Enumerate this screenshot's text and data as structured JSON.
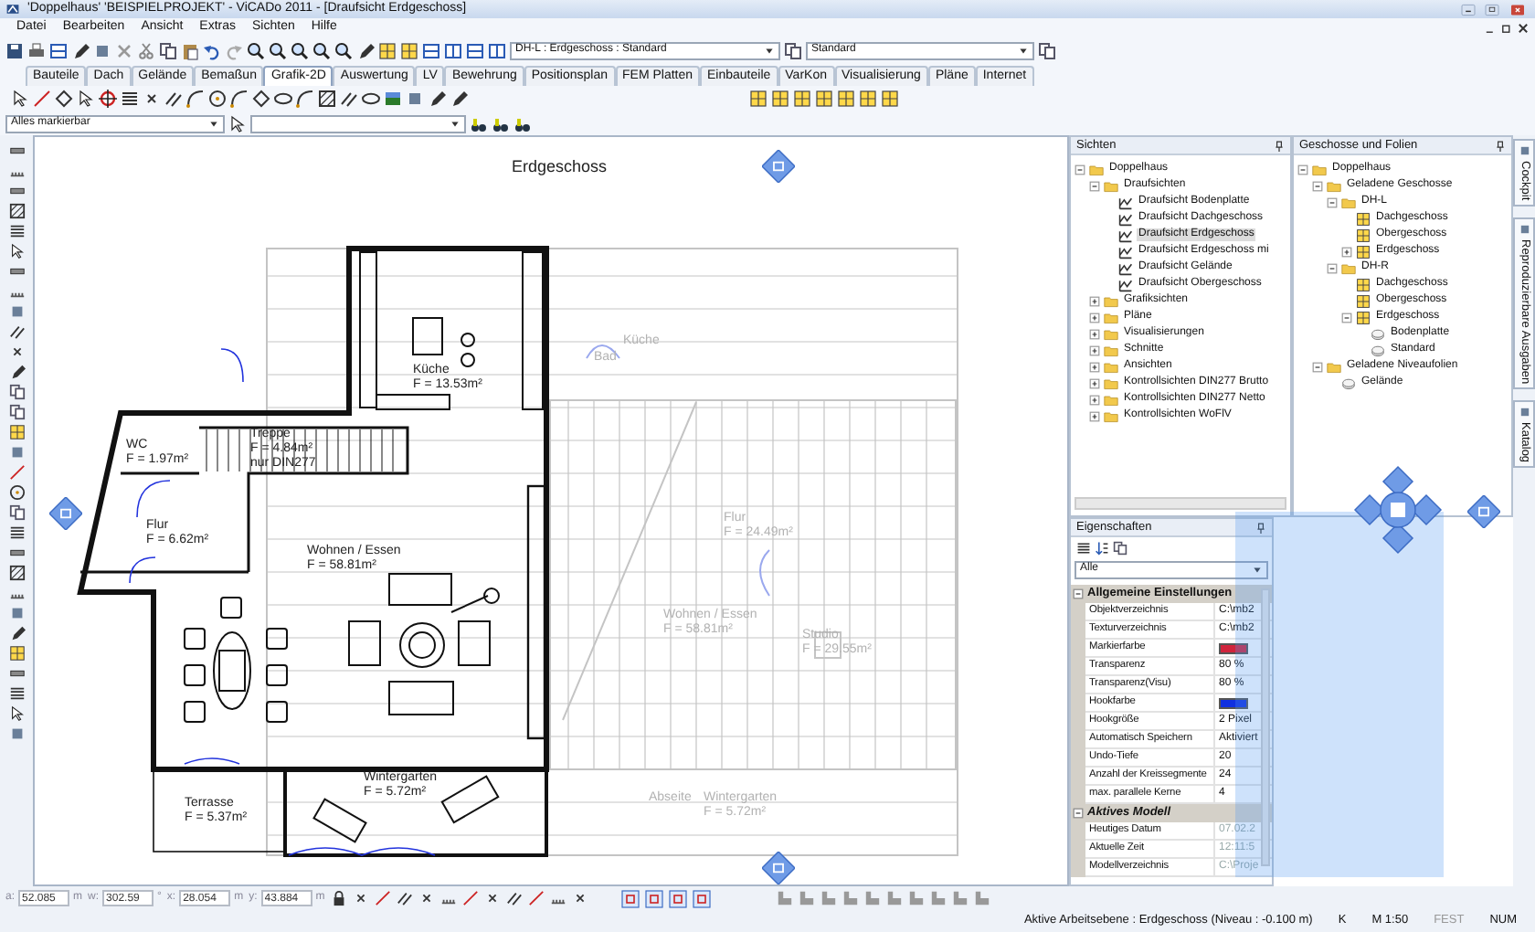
{
  "window": {
    "title": "'Doppelhaus' 'BEISPIELPROJEKT' - ViCADo 2011 - [Draufsicht Erdgeschoss]"
  },
  "menu": [
    "Datei",
    "Bearbeiten",
    "Ansicht",
    "Extras",
    "Sichten",
    "Hilfe"
  ],
  "toolbar": {
    "layer_combo": "DH-L : Erdgeschoss : Standard",
    "style_combo": "Standard"
  },
  "ribbon_tabs": [
    {
      "label": "Bauteile",
      "selected": false
    },
    {
      "label": "Dach",
      "selected": false
    },
    {
      "label": "Gelände",
      "selected": false
    },
    {
      "label": "Bemaßun",
      "selected": false
    },
    {
      "label": "Grafik-2D",
      "selected": true
    },
    {
      "label": "Auswertung",
      "selected": false
    },
    {
      "label": "LV",
      "selected": false
    },
    {
      "label": "Bewehrung",
      "selected": false
    },
    {
      "label": "Positionsplan",
      "selected": false
    },
    {
      "label": "FEM Platten",
      "selected": false
    },
    {
      "label": "Einbauteile",
      "selected": false
    },
    {
      "label": "VarKon",
      "selected": false
    },
    {
      "label": "Visualisierung",
      "selected": false
    },
    {
      "label": "Pläne",
      "selected": false
    },
    {
      "label": "Internet",
      "selected": false
    }
  ],
  "selection_filter": "Alles markierbar",
  "drawing": {
    "title": "Erdgeschoss",
    "rooms": [
      {
        "lines": [
          "Bad"
        ],
        "faded": true
      },
      {
        "lines": [
          "Küche"
        ],
        "faded": true
      },
      {
        "lines": [
          "Küche",
          "F = 13.53m²"
        ],
        "faded": false
      },
      {
        "lines": [
          "WC",
          "F = 1.97m²"
        ],
        "faded": false
      },
      {
        "lines": [
          "Treppe",
          "F = 4.84m²",
          "nur DIN277"
        ],
        "faded": false
      },
      {
        "lines": [
          "Flur",
          "F = 6.62m²"
        ],
        "faded": false
      },
      {
        "lines": [
          "Flur",
          "F = 24.49m²"
        ],
        "faded": true
      },
      {
        "lines": [
          "Wohnen / Essen",
          "F = 58.81m²"
        ],
        "faded": false
      },
      {
        "lines": [
          "Wohnen / Essen",
          "F = 58.81m²"
        ],
        "faded": true
      },
      {
        "lines": [
          "Studio",
          "F = 29.55m²"
        ],
        "faded": true
      },
      {
        "lines": [
          "Terrasse",
          "F = 5.37m²"
        ],
        "faded": false
      },
      {
        "lines": [
          "Wintergarten",
          "F = 5.72m²"
        ],
        "faded": false
      },
      {
        "lines": [
          "Abseite"
        ],
        "faded": true
      },
      {
        "lines": [
          "Wintergarten",
          "F = 5.72m²"
        ],
        "faded": true
      }
    ]
  },
  "views_panel": {
    "title": "Sichten",
    "tree": [
      {
        "label": "Doppelhaus",
        "kind": "folder",
        "expanded": true,
        "selected": false,
        "children": [
          {
            "label": "Draufsichten",
            "kind": "folder",
            "expanded": true,
            "selected": false,
            "children": [
              {
                "label": "Draufsicht Bodenplatte",
                "kind": "view",
                "selected": false
              },
              {
                "label": "Draufsicht Dachgeschoss",
                "kind": "view",
                "selected": false
              },
              {
                "label": "Draufsicht Erdgeschoss",
                "kind": "view",
                "selected": true
              },
              {
                "label": "Draufsicht Erdgeschoss mi",
                "kind": "view",
                "selected": false
              },
              {
                "label": "Draufsicht Gelände",
                "kind": "view",
                "selected": false
              },
              {
                "label": "Draufsicht Obergeschoss",
                "kind": "view",
                "selected": false
              }
            ]
          },
          {
            "label": "Grafiksichten",
            "kind": "folder",
            "expanded": false,
            "selected": false
          },
          {
            "label": "Pläne",
            "kind": "folder",
            "expanded": false,
            "selected": false
          },
          {
            "label": "Visualisierungen",
            "kind": "folder",
            "expanded": false,
            "selected": false
          },
          {
            "label": "Schnitte",
            "kind": "folder",
            "expanded": false,
            "selected": false
          },
          {
            "label": "Ansichten",
            "kind": "folder",
            "expanded": false,
            "selected": false
          },
          {
            "label": "Kontrollsichten DIN277 Brutto",
            "kind": "folder",
            "expanded": false,
            "selected": false
          },
          {
            "label": "Kontrollsichten DIN277 Netto",
            "kind": "folder",
            "expanded": false,
            "selected": false
          },
          {
            "label": "Kontrollsichten WoFlV",
            "kind": "folder",
            "expanded": false,
            "selected": false
          }
        ]
      }
    ]
  },
  "storeys_panel": {
    "title": "Geschosse und Folien",
    "tree": [
      {
        "label": "Doppelhaus",
        "kind": "folder",
        "expanded": true,
        "children": [
          {
            "label": "Geladene Geschosse",
            "kind": "folder",
            "expanded": true,
            "children": [
              {
                "label": "DH-L",
                "kind": "folder",
                "expanded": true,
                "children": [
                  {
                    "label": "Dachgeschoss",
                    "kind": "storey"
                  },
                  {
                    "label": "Obergeschoss",
                    "kind": "storey"
                  },
                  {
                    "label": "Erdgeschoss",
                    "kind": "storey",
                    "expanded": false
                  }
                ]
              },
              {
                "label": "DH-R",
                "kind": "folder",
                "expanded": true,
                "children": [
                  {
                    "label": "Dachgeschoss",
                    "kind": "storey"
                  },
                  {
                    "label": "Obergeschoss",
                    "kind": "storey"
                  },
                  {
                    "label": "Erdgeschoss",
                    "kind": "storey",
                    "expanded": true,
                    "children": [
                      {
                        "label": "Bodenplatte",
                        "kind": "layer"
                      },
                      {
                        "label": "Standard",
                        "kind": "layer"
                      }
                    ]
                  }
                ]
              }
            ]
          },
          {
            "label": "Geladene Niveaufolien",
            "kind": "folder",
            "expanded": true,
            "children": [
              {
                "label": "Gelände",
                "kind": "layer"
              }
            ]
          }
        ]
      }
    ]
  },
  "properties_panel": {
    "title": "Eigenschaften",
    "filter": "Alle",
    "rows": [
      {
        "kind": "group",
        "label": "Allgemeine Einstellungen",
        "italic": false
      },
      {
        "kind": "text",
        "name": "Objektverzeichnis",
        "value": "C:\\mb2",
        "disabled": false
      },
      {
        "kind": "text",
        "name": "Texturverzeichnis",
        "value": "C:\\mb2",
        "disabled": false
      },
      {
        "kind": "color",
        "name": "Markierfarbe",
        "color": "#d0243c"
      },
      {
        "kind": "text",
        "name": "Transparenz",
        "value": "80 %",
        "disabled": false
      },
      {
        "kind": "text",
        "name": "Transparenz(Visu)",
        "value": "80 %",
        "disabled": false
      },
      {
        "kind": "color",
        "name": "Hookfarbe",
        "color": "#1030e0"
      },
      {
        "kind": "text",
        "name": "Hookgröße",
        "value": "2 Pixel",
        "disabled": false
      },
      {
        "kind": "text",
        "name": "Automatisch Speichern",
        "value": "Aktiviert",
        "disabled": false
      },
      {
        "kind": "text",
        "name": "Undo-Tiefe",
        "value": "20",
        "disabled": false
      },
      {
        "kind": "text",
        "name": "Anzahl der Kreissegmente",
        "value": "24",
        "disabled": false
      },
      {
        "kind": "text",
        "name": "max. parallele Kerne",
        "value": "4",
        "disabled": false
      },
      {
        "kind": "group",
        "label": "Aktives Modell",
        "italic": true
      },
      {
        "kind": "text",
        "name": "Heutiges Datum",
        "value": "07.02.2",
        "disabled": true
      },
      {
        "kind": "text",
        "name": "Aktuelle Zeit",
        "value": "12:11:5",
        "disabled": true
      },
      {
        "kind": "text",
        "name": "Modellverzeichnis",
        "value": "C:\\Proje",
        "disabled": true
      }
    ]
  },
  "side_tabs": [
    "Cockpit",
    "Reproduzierbare Ausgaben",
    "Katalog"
  ],
  "coordinates": [
    {
      "label": "a:",
      "value": "52.085",
      "unit": "m"
    },
    {
      "label": "w:",
      "value": "302.59",
      "unit": "°"
    },
    {
      "label": "x:",
      "value": "28.054",
      "unit": "m"
    },
    {
      "label": "y:",
      "value": "43.884",
      "unit": "m"
    }
  ],
  "status_bar": {
    "text": "Aktive Arbeitsebene : Erdgeschoss (Niveau : -0.100 m)",
    "indicators": [
      {
        "label": "K",
        "on": true
      },
      {
        "label": "M 1:50",
        "on": true
      },
      {
        "label": "FEST",
        "on": false
      },
      {
        "label": "NUM",
        "on": true
      }
    ]
  }
}
